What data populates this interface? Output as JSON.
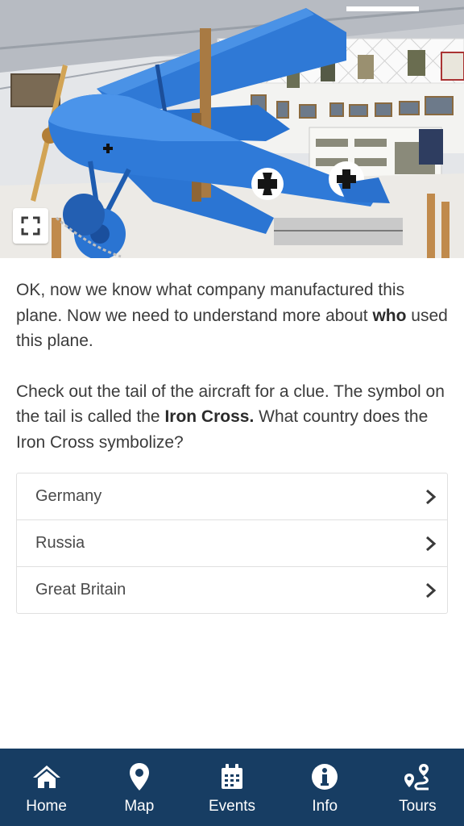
{
  "hero": {
    "image": "blue-triplane-museum-photo",
    "expand_icon": "expand-icon"
  },
  "question": {
    "paragraph1": {
      "before_bold": "OK, now we know what company manufactured this plane. Now we need to understand more about ",
      "bold": "who",
      "after_bold": " used this plane."
    },
    "paragraph2": {
      "before_bold": "Check out the tail of the aircraft for a clue. The symbol on the tail is called the ",
      "bold": "Iron Cross.",
      "after_bold": " What country does the Iron Cross symbolize?"
    }
  },
  "options": [
    {
      "label": "Germany",
      "icon": "chevron-right-icon"
    },
    {
      "label": "Russia",
      "icon": "chevron-right-icon"
    },
    {
      "label": "Great Britain",
      "icon": "chevron-right-icon"
    }
  ],
  "tabbar": {
    "background": "#173d63",
    "tabs": [
      {
        "label": "Home",
        "icon": "home-icon"
      },
      {
        "label": "Map",
        "icon": "map-pin-icon"
      },
      {
        "label": "Events",
        "icon": "calendar-icon"
      },
      {
        "label": "Info",
        "icon": "info-icon"
      },
      {
        "label": "Tours",
        "icon": "route-icon"
      }
    ]
  }
}
